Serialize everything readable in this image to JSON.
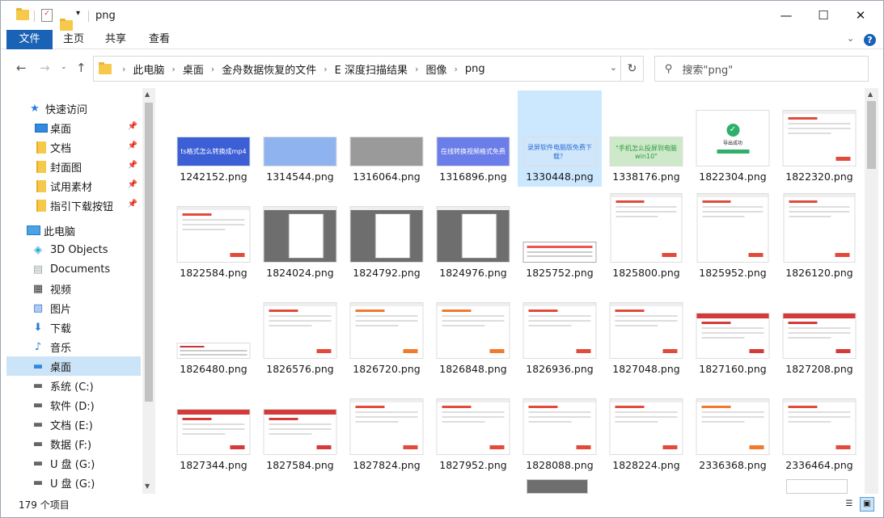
{
  "window": {
    "title": "png",
    "min": "—",
    "max": "☐",
    "close": "✕"
  },
  "ribbon": {
    "tabs": [
      "文件",
      "主页",
      "共享",
      "查看"
    ],
    "help": "?"
  },
  "address": {
    "crumbs": [
      "此电脑",
      "桌面",
      "金舟数据恢复的文件",
      "E 深度扫描结果",
      "图像",
      "png"
    ]
  },
  "search": {
    "placeholder": "搜索\"png\""
  },
  "sidebar": {
    "quick_access": "快速访问",
    "pinned": [
      "桌面",
      "文档",
      "封面图",
      "试用素材",
      "指引下载按钮"
    ],
    "this_pc": "此电脑",
    "pc_items": [
      "3D Objects",
      "Documents",
      "视频",
      "图片",
      "下载",
      "音乐",
      "桌面",
      "系统 (C:)",
      "软件 (D:)",
      "文档 (E:)",
      "数据 (F:)",
      "U 盘 (G:)",
      "U 盘 (G:)"
    ]
  },
  "files": [
    {
      "name": "1242152.png",
      "kind": "banner-blue",
      "text": "ts格式怎么转换成mp4"
    },
    {
      "name": "1314544.png",
      "kind": "banner-light",
      "text": ""
    },
    {
      "name": "1316064.png",
      "kind": "banner-gray",
      "text": ""
    },
    {
      "name": "1316896.png",
      "kind": "banner-violet",
      "text": "在线转换视频格式免费"
    },
    {
      "name": "1330448.png",
      "kind": "banner-cyan",
      "text": "录屏软件电脑版免费下载？"
    },
    {
      "name": "1338176.png",
      "kind": "banner-green",
      "text": "\"手机怎么投屏到电脑win10\""
    },
    {
      "name": "1822304.png",
      "kind": "dialog-ok",
      "text": "导出成功"
    },
    {
      "name": "1822320.png",
      "kind": "shot"
    },
    {
      "name": "1822584.png",
      "kind": "shot"
    },
    {
      "name": "1824024.png",
      "kind": "shot-doc"
    },
    {
      "name": "1824792.png",
      "kind": "shot-doc"
    },
    {
      "name": "1824976.png",
      "kind": "shot-doc"
    },
    {
      "name": "1825752.png",
      "kind": "menu"
    },
    {
      "name": "1825800.png",
      "kind": "shot-tall"
    },
    {
      "name": "1825952.png",
      "kind": "shot-tall"
    },
    {
      "name": "1826120.png",
      "kind": "shot-tall"
    },
    {
      "name": "1826480.png",
      "kind": "strip"
    },
    {
      "name": "1826576.png",
      "kind": "shot"
    },
    {
      "name": "1826720.png",
      "kind": "shot-orange"
    },
    {
      "name": "1826848.png",
      "kind": "shot-orange"
    },
    {
      "name": "1826936.png",
      "kind": "shot"
    },
    {
      "name": "1827048.png",
      "kind": "shot"
    },
    {
      "name": "1827160.png",
      "kind": "shot-red"
    },
    {
      "name": "1827208.png",
      "kind": "shot-red"
    },
    {
      "name": "1827344.png",
      "kind": "shot-red"
    },
    {
      "name": "1827584.png",
      "kind": "shot-red"
    },
    {
      "name": "1827824.png",
      "kind": "shot"
    },
    {
      "name": "1827952.png",
      "kind": "shot"
    },
    {
      "name": "1828088.png",
      "kind": "shot"
    },
    {
      "name": "1828224.png",
      "kind": "shot"
    },
    {
      "name": "2336368.png",
      "kind": "shot-orange"
    },
    {
      "name": "2336464.png",
      "kind": "shot"
    }
  ],
  "status": {
    "count": "179 个项目"
  }
}
